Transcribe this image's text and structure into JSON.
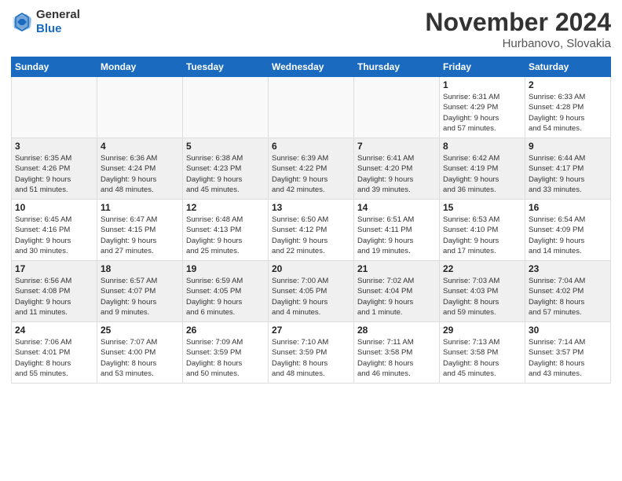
{
  "logo": {
    "general": "General",
    "blue": "Blue"
  },
  "title": "November 2024",
  "location": "Hurbanovo, Slovakia",
  "days_of_week": [
    "Sunday",
    "Monday",
    "Tuesday",
    "Wednesday",
    "Thursday",
    "Friday",
    "Saturday"
  ],
  "weeks": [
    [
      {
        "day": "",
        "info": ""
      },
      {
        "day": "",
        "info": ""
      },
      {
        "day": "",
        "info": ""
      },
      {
        "day": "",
        "info": ""
      },
      {
        "day": "",
        "info": ""
      },
      {
        "day": "1",
        "info": "Sunrise: 6:31 AM\nSunset: 4:29 PM\nDaylight: 9 hours\nand 57 minutes."
      },
      {
        "day": "2",
        "info": "Sunrise: 6:33 AM\nSunset: 4:28 PM\nDaylight: 9 hours\nand 54 minutes."
      }
    ],
    [
      {
        "day": "3",
        "info": "Sunrise: 6:35 AM\nSunset: 4:26 PM\nDaylight: 9 hours\nand 51 minutes."
      },
      {
        "day": "4",
        "info": "Sunrise: 6:36 AM\nSunset: 4:24 PM\nDaylight: 9 hours\nand 48 minutes."
      },
      {
        "day": "5",
        "info": "Sunrise: 6:38 AM\nSunset: 4:23 PM\nDaylight: 9 hours\nand 45 minutes."
      },
      {
        "day": "6",
        "info": "Sunrise: 6:39 AM\nSunset: 4:22 PM\nDaylight: 9 hours\nand 42 minutes."
      },
      {
        "day": "7",
        "info": "Sunrise: 6:41 AM\nSunset: 4:20 PM\nDaylight: 9 hours\nand 39 minutes."
      },
      {
        "day": "8",
        "info": "Sunrise: 6:42 AM\nSunset: 4:19 PM\nDaylight: 9 hours\nand 36 minutes."
      },
      {
        "day": "9",
        "info": "Sunrise: 6:44 AM\nSunset: 4:17 PM\nDaylight: 9 hours\nand 33 minutes."
      }
    ],
    [
      {
        "day": "10",
        "info": "Sunrise: 6:45 AM\nSunset: 4:16 PM\nDaylight: 9 hours\nand 30 minutes."
      },
      {
        "day": "11",
        "info": "Sunrise: 6:47 AM\nSunset: 4:15 PM\nDaylight: 9 hours\nand 27 minutes."
      },
      {
        "day": "12",
        "info": "Sunrise: 6:48 AM\nSunset: 4:13 PM\nDaylight: 9 hours\nand 25 minutes."
      },
      {
        "day": "13",
        "info": "Sunrise: 6:50 AM\nSunset: 4:12 PM\nDaylight: 9 hours\nand 22 minutes."
      },
      {
        "day": "14",
        "info": "Sunrise: 6:51 AM\nSunset: 4:11 PM\nDaylight: 9 hours\nand 19 minutes."
      },
      {
        "day": "15",
        "info": "Sunrise: 6:53 AM\nSunset: 4:10 PM\nDaylight: 9 hours\nand 17 minutes."
      },
      {
        "day": "16",
        "info": "Sunrise: 6:54 AM\nSunset: 4:09 PM\nDaylight: 9 hours\nand 14 minutes."
      }
    ],
    [
      {
        "day": "17",
        "info": "Sunrise: 6:56 AM\nSunset: 4:08 PM\nDaylight: 9 hours\nand 11 minutes."
      },
      {
        "day": "18",
        "info": "Sunrise: 6:57 AM\nSunset: 4:07 PM\nDaylight: 9 hours\nand 9 minutes."
      },
      {
        "day": "19",
        "info": "Sunrise: 6:59 AM\nSunset: 4:05 PM\nDaylight: 9 hours\nand 6 minutes."
      },
      {
        "day": "20",
        "info": "Sunrise: 7:00 AM\nSunset: 4:05 PM\nDaylight: 9 hours\nand 4 minutes."
      },
      {
        "day": "21",
        "info": "Sunrise: 7:02 AM\nSunset: 4:04 PM\nDaylight: 9 hours\nand 1 minute."
      },
      {
        "day": "22",
        "info": "Sunrise: 7:03 AM\nSunset: 4:03 PM\nDaylight: 8 hours\nand 59 minutes."
      },
      {
        "day": "23",
        "info": "Sunrise: 7:04 AM\nSunset: 4:02 PM\nDaylight: 8 hours\nand 57 minutes."
      }
    ],
    [
      {
        "day": "24",
        "info": "Sunrise: 7:06 AM\nSunset: 4:01 PM\nDaylight: 8 hours\nand 55 minutes."
      },
      {
        "day": "25",
        "info": "Sunrise: 7:07 AM\nSunset: 4:00 PM\nDaylight: 8 hours\nand 53 minutes."
      },
      {
        "day": "26",
        "info": "Sunrise: 7:09 AM\nSunset: 3:59 PM\nDaylight: 8 hours\nand 50 minutes."
      },
      {
        "day": "27",
        "info": "Sunrise: 7:10 AM\nSunset: 3:59 PM\nDaylight: 8 hours\nand 48 minutes."
      },
      {
        "day": "28",
        "info": "Sunrise: 7:11 AM\nSunset: 3:58 PM\nDaylight: 8 hours\nand 46 minutes."
      },
      {
        "day": "29",
        "info": "Sunrise: 7:13 AM\nSunset: 3:58 PM\nDaylight: 8 hours\nand 45 minutes."
      },
      {
        "day": "30",
        "info": "Sunrise: 7:14 AM\nSunset: 3:57 PM\nDaylight: 8 hours\nand 43 minutes."
      }
    ]
  ]
}
